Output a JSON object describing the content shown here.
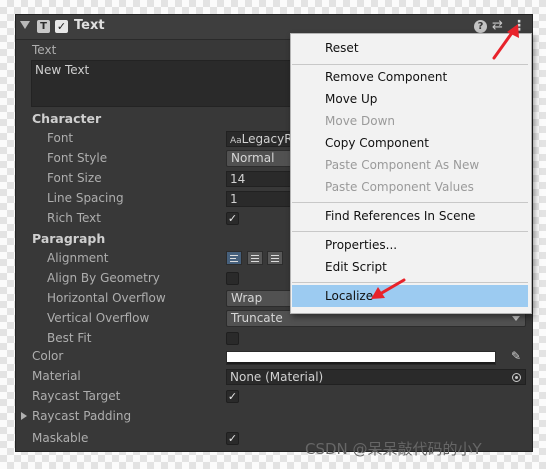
{
  "header": {
    "title": "Text",
    "component_icon": "T",
    "enabled_check": "✓",
    "help_icon": "?",
    "presets_icon": "⇄",
    "menu_icon": "⋮"
  },
  "text_field": {
    "label": "Text",
    "value": "New Text"
  },
  "character": {
    "heading": "Character",
    "font": {
      "label": "Font",
      "value": "LegacyR",
      "icon": "Aa"
    },
    "font_style": {
      "label": "Font Style",
      "value": "Normal"
    },
    "font_size": {
      "label": "Font Size",
      "value": "14"
    },
    "line_spacing": {
      "label": "Line Spacing",
      "value": "1"
    },
    "rich_text": {
      "label": "Rich Text",
      "checked": "✓"
    }
  },
  "paragraph": {
    "heading": "Paragraph",
    "alignment": {
      "label": "Alignment"
    },
    "align_by_geometry": {
      "label": "Align By Geometry",
      "checked": ""
    },
    "horizontal_overflow": {
      "label": "Horizontal Overflow",
      "value": "Wrap"
    },
    "vertical_overflow": {
      "label": "Vertical Overflow",
      "value": "Truncate"
    },
    "best_fit": {
      "label": "Best Fit",
      "checked": ""
    }
  },
  "color": {
    "label": "Color",
    "value": "#ffffff"
  },
  "material": {
    "label": "Material",
    "value": "None (Material)"
  },
  "raycast_target": {
    "label": "Raycast Target",
    "checked": "✓"
  },
  "raycast_padding": {
    "label": "Raycast Padding"
  },
  "maskable": {
    "label": "Maskable",
    "checked": "✓"
  },
  "context_menu": {
    "reset": "Reset",
    "remove_component": "Remove Component",
    "move_up": "Move Up",
    "move_down": "Move Down",
    "copy_component": "Copy Component",
    "paste_as_new": "Paste Component As New",
    "paste_values": "Paste Component Values",
    "find_references": "Find References In Scene",
    "properties": "Properties...",
    "edit_script": "Edit Script",
    "localize": "Localize"
  },
  "colors": {
    "panel_bg": "#383838",
    "menu_bg": "#f2f2f2",
    "selection": "#9ccbf1",
    "annotation_arrow": "#e8232b"
  },
  "watermark": "CSDN @呆呆敲代码的小Y"
}
